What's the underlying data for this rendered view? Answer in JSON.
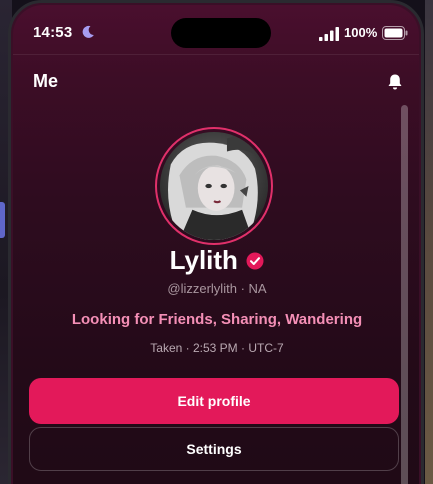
{
  "status_bar": {
    "time": "14:53",
    "battery_percent": "100%",
    "icons": [
      "moon-icon",
      "signal-icon",
      "battery-icon"
    ]
  },
  "header": {
    "title": "Me",
    "notifications_icon": "bell-icon"
  },
  "profile": {
    "display_name": "Lylith",
    "verified_icon": "verified-badge-icon",
    "handle": "@lizzerlylith",
    "handle_separator": "·",
    "location": "NA",
    "bio": "Looking for Friends, Sharing, Wandering",
    "relationship_status": "Taken",
    "meta_separator": "·",
    "local_time": "2:53 PM",
    "timezone": "UTC-7"
  },
  "actions": {
    "edit_profile_label": "Edit profile",
    "settings_label": "Settings"
  },
  "colors": {
    "accent": "#e3195a",
    "bio_text": "#f48fb6",
    "background_top": "#4a0f2e",
    "background_bottom": "#1f0a16"
  }
}
